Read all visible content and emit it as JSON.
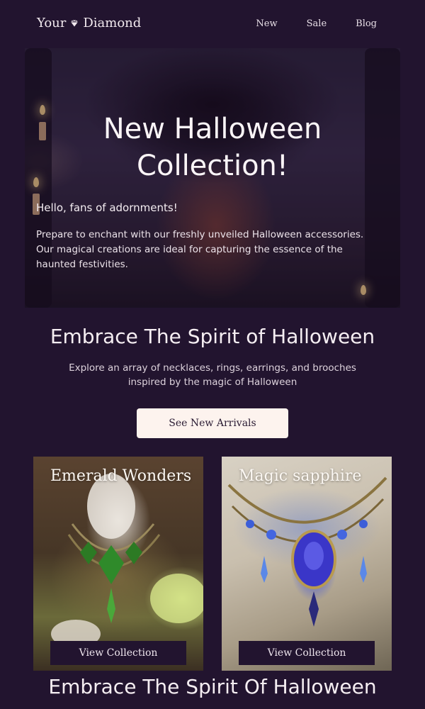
{
  "header": {
    "logo_left": "Your",
    "logo_right": "Diamond",
    "nav": [
      "New",
      "Sale",
      "Blog"
    ]
  },
  "hero": {
    "title": "New Halloween Collection!",
    "greeting": "Hello, fans of adornments!",
    "body": "Prepare to enchant with our freshly unveiled Halloween accessories. Our magical creations are ideal for capturing the essence of the haunted festivities."
  },
  "section": {
    "title": "Embrace The Spirit of Halloween",
    "text": "Explore an array of necklaces, rings, earrings, and brooches inspired by the magic of Halloween",
    "cta_label": "See New Arrivals"
  },
  "cards": [
    {
      "title": "Emerald Wonders",
      "button": "View Collection"
    },
    {
      "title": "Magic sapphire",
      "button": "View Collection"
    }
  ],
  "footer": {
    "title": "Embrace The Spirit Of Halloween"
  },
  "colors": {
    "background": "#22142f",
    "button_light": "#fdf3ee",
    "text": "#f3ecf1"
  },
  "icons": {
    "logo_icon": "diamond-icon"
  }
}
